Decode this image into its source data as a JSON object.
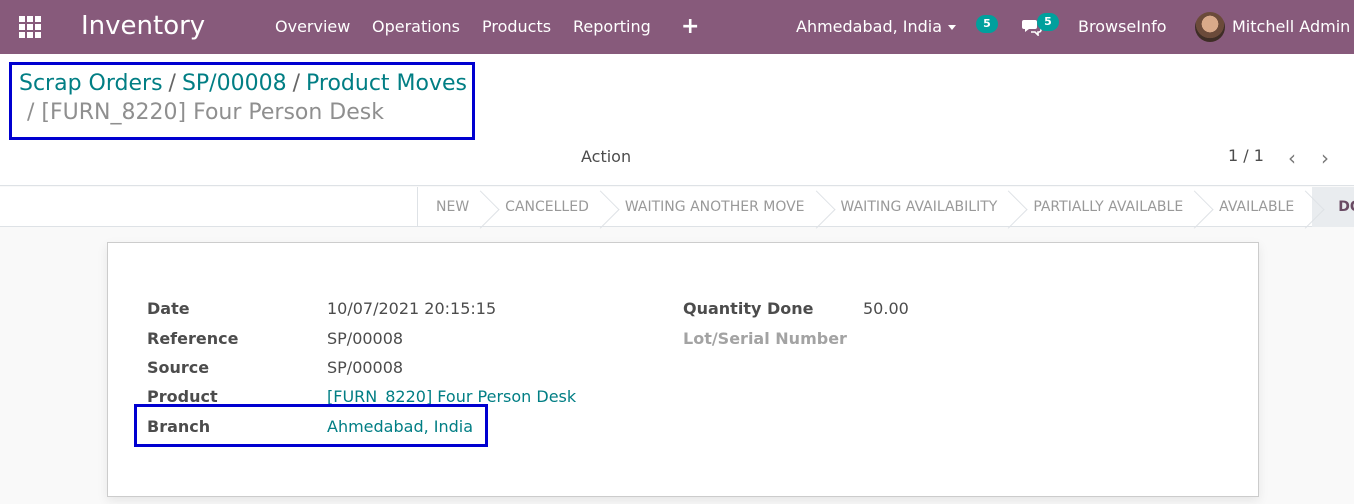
{
  "navbar": {
    "brand": "Inventory",
    "menu": [
      "Overview",
      "Operations",
      "Products",
      "Reporting"
    ],
    "branch": "Ahmedabad, India",
    "activity_count": "5",
    "message_count": "5",
    "company": "BrowseInfo",
    "user": "Mitchell Admin",
    "colors": {
      "navbar_bg": "#875a7b",
      "badge": "#00a09d"
    }
  },
  "breadcrumb": {
    "items": [
      "Scrap Orders",
      "SP/00008",
      "Product Moves"
    ],
    "current": "[FURN_8220] Four Person Desk",
    "separator": "/"
  },
  "control": {
    "action_label": "Action",
    "pager": "1 / 1"
  },
  "statusbar": {
    "stages": [
      "NEW",
      "CANCELLED",
      "WAITING ANOTHER MOVE",
      "WAITING AVAILABILITY",
      "PARTIALLY AVAILABLE",
      "AVAILABLE",
      "DONE"
    ],
    "active_stage": "DONE"
  },
  "form": {
    "date_label": "Date",
    "date_value": "10/07/2021 20:15:15",
    "reference_label": "Reference",
    "reference_value": "SP/00008",
    "source_label": "Source",
    "source_value": "SP/00008",
    "product_label": "Product",
    "product_value": "[FURN_8220] Four Person Desk",
    "branch_label": "Branch",
    "branch_value": "Ahmedabad, India",
    "qty_done_label": "Quantity Done",
    "qty_done_value": "50.00",
    "lot_label": "Lot/Serial Number"
  },
  "colors": {
    "link": "#017e84",
    "highlight": "#0000d0"
  }
}
